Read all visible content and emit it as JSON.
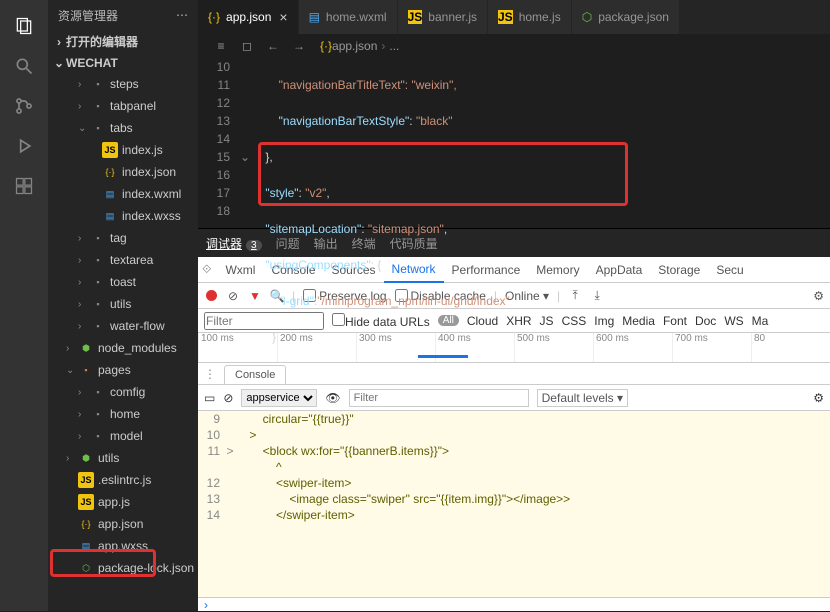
{
  "sidebar": {
    "title": "资源管理器",
    "sections": {
      "openEditors": "打开的编辑器",
      "project": "WECHAT"
    },
    "tree": [
      {
        "label": "steps",
        "type": "folder",
        "indent": 2,
        "chev": "›"
      },
      {
        "label": "tabpanel",
        "type": "folder",
        "indent": 2,
        "chev": "›"
      },
      {
        "label": "tabs",
        "type": "folder",
        "indent": 2,
        "chev": "⌄"
      },
      {
        "label": "index.js",
        "type": "js",
        "indent": 3
      },
      {
        "label": "index.json",
        "type": "json",
        "indent": 3
      },
      {
        "label": "index.wxml",
        "type": "wxml",
        "indent": 3
      },
      {
        "label": "index.wxss",
        "type": "wxss",
        "indent": 3
      },
      {
        "label": "tag",
        "type": "folder",
        "indent": 2,
        "chev": "›"
      },
      {
        "label": "textarea",
        "type": "folder",
        "indent": 2,
        "chev": "›"
      },
      {
        "label": "toast",
        "type": "folder",
        "indent": 2,
        "chev": "›"
      },
      {
        "label": "utils",
        "type": "folder",
        "indent": 2,
        "chev": "›"
      },
      {
        "label": "water-flow",
        "type": "folder",
        "indent": 2,
        "chev": "›"
      },
      {
        "label": "node_modules",
        "type": "folder-green",
        "indent": 1,
        "chev": "›"
      },
      {
        "label": "pages",
        "type": "folder-orange",
        "indent": 1,
        "chev": "⌄"
      },
      {
        "label": "comfig",
        "type": "folder",
        "indent": 2,
        "chev": "›"
      },
      {
        "label": "home",
        "type": "folder",
        "indent": 2,
        "chev": "›"
      },
      {
        "label": "model",
        "type": "folder",
        "indent": 2,
        "chev": "›"
      },
      {
        "label": "utils",
        "type": "folder-green",
        "indent": 1,
        "chev": "›"
      },
      {
        "label": ".eslintrc.js",
        "type": "js",
        "indent": 1
      },
      {
        "label": "app.js",
        "type": "js",
        "indent": 1
      },
      {
        "label": "app.json",
        "type": "json",
        "indent": 1
      },
      {
        "label": "app.wxss",
        "type": "wxss",
        "indent": 1
      },
      {
        "label": "package-lock.json",
        "type": "hex",
        "indent": 1
      }
    ]
  },
  "tabs": [
    {
      "label": "app.json",
      "icon": "json",
      "active": true,
      "close": true
    },
    {
      "label": "home.wxml",
      "icon": "wxml"
    },
    {
      "label": "banner.js",
      "icon": "js"
    },
    {
      "label": "home.js",
      "icon": "js"
    },
    {
      "label": "package.json",
      "icon": "hex"
    }
  ],
  "breadcrumb": {
    "file": "app.json",
    "tail": "..."
  },
  "code": {
    "lines": [
      10,
      11,
      12,
      13,
      14,
      15,
      16,
      17,
      18
    ],
    "l10": "\"navigationBarTitleText\": \"weixin\",",
    "l11_k": "\"navigationBarTextStyle\"",
    "l11_v": "\"black\"",
    "l13_k": "\"style\"",
    "l13_v": "\"v2\"",
    "l14_k": "\"sitemapLocation\"",
    "l14_v": "\"sitemap.json\"",
    "l15_k": "\"usingComponents\"",
    "l16_k": "\"l-grid\"",
    "l16_v": "\"/miniprogram_npm/lin-ui/grid/index\""
  },
  "panel": {
    "tabs": {
      "debugger": "调试器",
      "debugger_badge": "3",
      "problems": "问题",
      "output": "输出",
      "terminal": "终端",
      "quality": "代码质量"
    }
  },
  "dev": {
    "tabs": [
      "Wxml",
      "Console",
      "Sources",
      "Network",
      "Performance",
      "Memory",
      "AppData",
      "Storage",
      "Secu"
    ],
    "active": "Network",
    "toolbar": {
      "preserve": "Preserve log",
      "disable": "Disable cache",
      "online": "Online"
    },
    "filter": {
      "placeholder": "Filter",
      "hide": "Hide data URLs",
      "all": "All",
      "types": [
        "Cloud",
        "XHR",
        "JS",
        "CSS",
        "Img",
        "Media",
        "Font",
        "Doc",
        "WS",
        "Ma"
      ]
    },
    "ticks": [
      "100 ms",
      "200 ms",
      "300 ms",
      "400 ms",
      "500 ms",
      "600 ms",
      "700 ms",
      "80"
    ],
    "drawer": "Console",
    "console": {
      "context": "appservice",
      "filter_ph": "Filter",
      "levels": "Default levels ▾",
      "rows": [
        {
          "n": 9,
          "t": "        circular=\"{{true}}\""
        },
        {
          "n": 10,
          "t": "    >"
        },
        {
          "n": 11,
          "t": "        <block wx:for=\"{{bannerB.items}}\">",
          "g": ">"
        },
        {
          "n": "",
          "t": "            ^"
        },
        {
          "n": 12,
          "t": "            <swiper-item>"
        },
        {
          "n": 13,
          "t": "                <image class=\"swiper\" src=\"{{item.img}}\"></image>>"
        },
        {
          "n": 14,
          "t": "            </swiper-item>"
        }
      ]
    }
  }
}
